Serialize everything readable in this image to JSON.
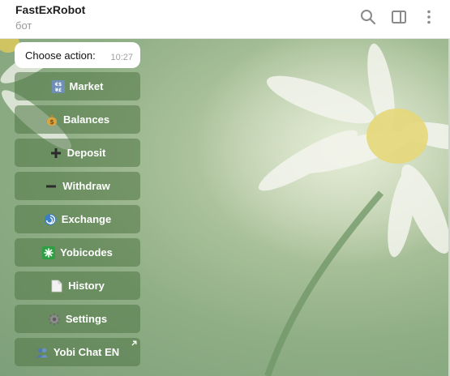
{
  "header": {
    "title": "FastExRobot",
    "subtitle": "бот",
    "icons": [
      "search-icon",
      "sidebar-toggle-icon",
      "more-vertical-icon"
    ]
  },
  "message": {
    "text": "Choose action:",
    "time": "10:27"
  },
  "keyboard": {
    "buttons": [
      {
        "label": "Market",
        "icon": "exchange-rates-icon"
      },
      {
        "label": "Balances",
        "icon": "money-bag-icon"
      },
      {
        "label": "Deposit",
        "icon": "plus-icon"
      },
      {
        "label": "Withdraw",
        "icon": "minus-icon"
      },
      {
        "label": "Exchange",
        "icon": "cyclone-icon"
      },
      {
        "label": "Yobicodes",
        "icon": "sparkle-icon"
      },
      {
        "label": "History",
        "icon": "document-icon"
      },
      {
        "label": "Settings",
        "icon": "gear-icon"
      },
      {
        "label": "Yobi Chat EN",
        "icon": "people-icon",
        "external": true
      }
    ]
  },
  "colors": {
    "header_bg": "#ffffff",
    "button_bg": "rgba(80,118,70,0.55)",
    "button_text": "#ffffff"
  }
}
